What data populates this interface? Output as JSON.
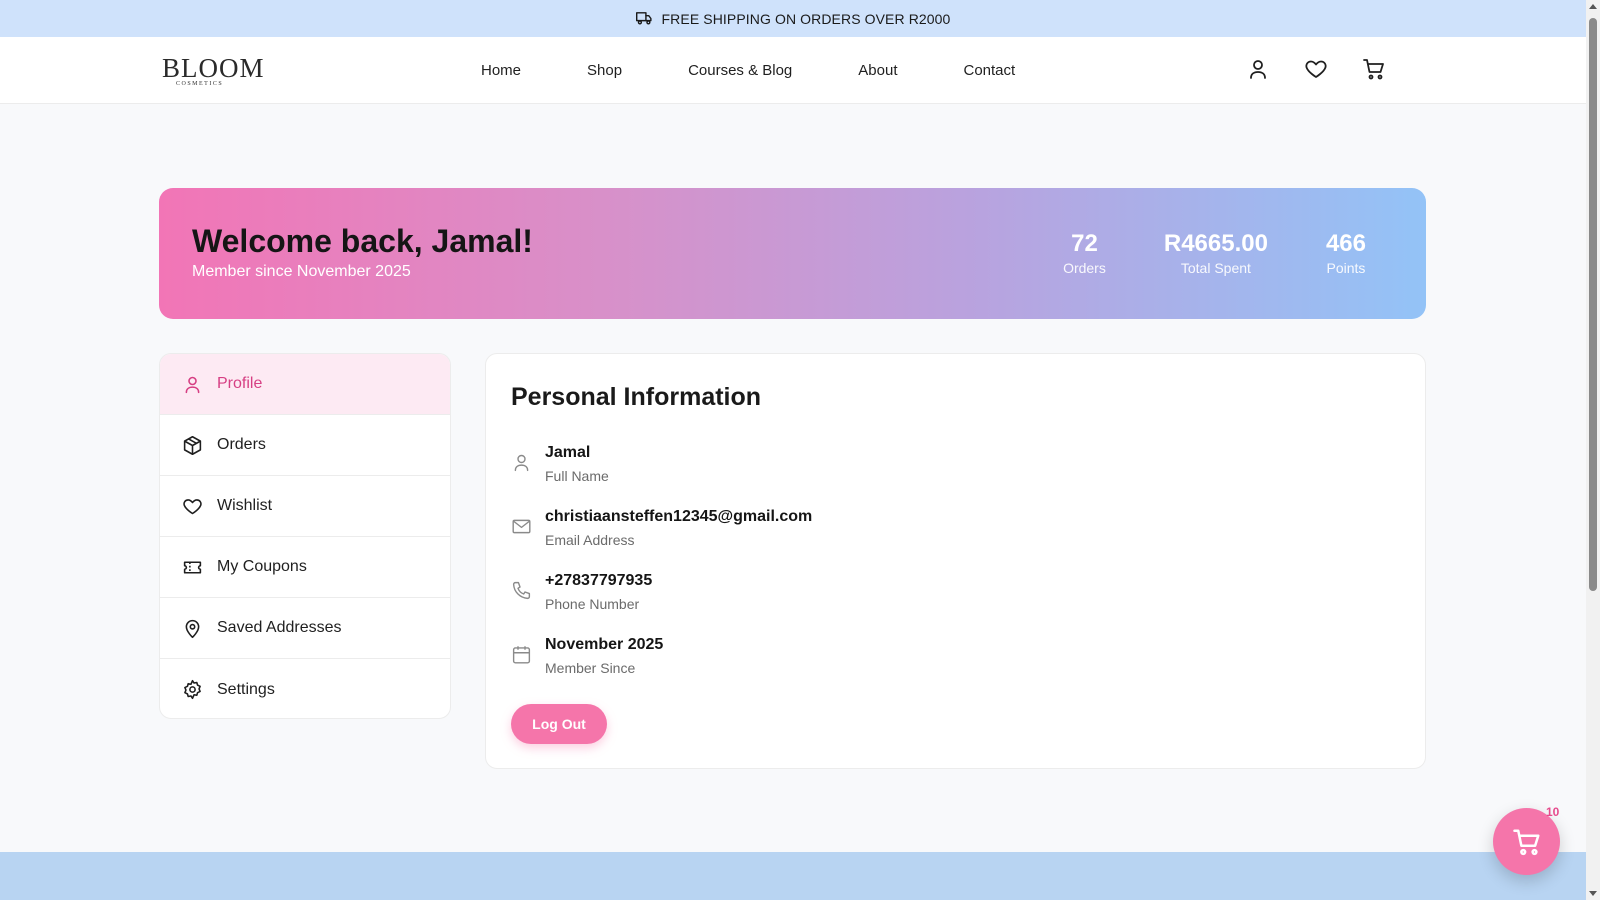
{
  "announcement": {
    "text": "FREE SHIPPING ON ORDERS OVER R2000",
    "icon": "truck-icon"
  },
  "header": {
    "logo_text": "BLOOM",
    "logo_subtext": "COSMETICS",
    "nav": [
      {
        "label": "Home"
      },
      {
        "label": "Shop"
      },
      {
        "label": "Courses & Blog"
      },
      {
        "label": "About"
      },
      {
        "label": "Contact"
      }
    ],
    "icons": [
      "user-icon",
      "heart-icon",
      "cart-icon"
    ]
  },
  "banner": {
    "greeting": "Welcome back, Jamal!",
    "member_since": "Member since November 2025",
    "stats": [
      {
        "value": "72",
        "label": "Orders"
      },
      {
        "value": "R4665.00",
        "label": "Total Spent"
      },
      {
        "value": "466",
        "label": "Points"
      }
    ],
    "gradient_start": "#f275b6",
    "gradient_end": "#93c3f7"
  },
  "sidebar": {
    "items": [
      {
        "label": "Profile",
        "icon": "user-icon",
        "active": true
      },
      {
        "label": "Orders",
        "icon": "package-icon",
        "active": false
      },
      {
        "label": "Wishlist",
        "icon": "heart-icon",
        "active": false
      },
      {
        "label": "My Coupons",
        "icon": "ticket-icon",
        "active": false
      },
      {
        "label": "Saved Addresses",
        "icon": "map-pin-icon",
        "active": false
      },
      {
        "label": "Settings",
        "icon": "gear-icon",
        "active": false
      }
    ]
  },
  "profile": {
    "title": "Personal Information",
    "fields": [
      {
        "value": "Jamal",
        "label": "Full Name",
        "icon": "user-icon"
      },
      {
        "value": "christiaansteffen12345@gmail.com",
        "label": "Email Address",
        "icon": "mail-icon"
      },
      {
        "value": "+27837797935",
        "label": "Phone Number",
        "icon": "phone-icon"
      },
      {
        "value": "November 2025",
        "label": "Member Since",
        "icon": "calendar-icon"
      }
    ],
    "logout_label": "Log Out"
  },
  "floating_cart": {
    "badge": "10",
    "icon": "cart-icon"
  },
  "colors": {
    "accent": "#f575aa",
    "active_text": "#d63f83",
    "topbar": "#cfe2fb",
    "footer": "#b8d4f2"
  }
}
